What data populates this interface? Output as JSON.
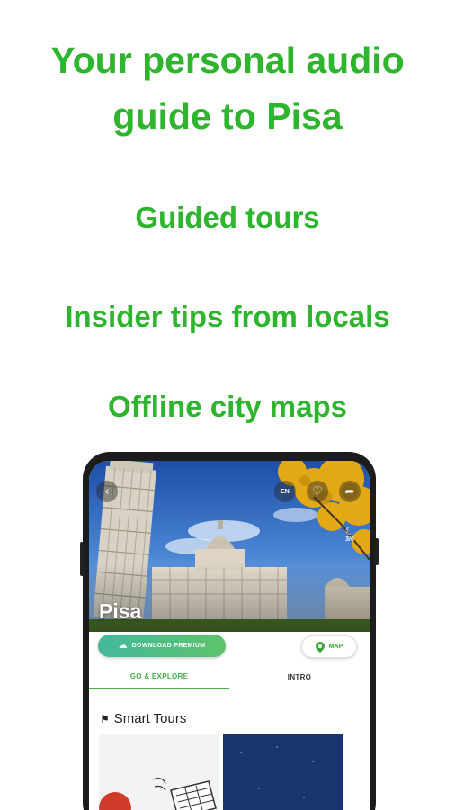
{
  "headline": "Your personal audio guide to Pisa",
  "headline_lines": [
    "Your personal audio",
    "guide to Pisa"
  ],
  "features": [
    "Guided tours",
    "Insider tips from locals",
    "Offline city maps"
  ],
  "colors": {
    "accent": "#2db52d",
    "tab_active": "#45b045",
    "download_gradient": [
      "#43b99d",
      "#5dc36b"
    ]
  },
  "phone": {
    "header_icons": {
      "back": "chevron-left-icon",
      "language": "EN",
      "favorite": "heart-icon",
      "share": "share-icon"
    },
    "night_mode": {
      "icon": "moon-icon",
      "value": "3/6"
    },
    "city_title": "Pisa",
    "download_button": {
      "icon": "cloud-download-icon",
      "label": "DOWNLOAD PREMIUM"
    },
    "map_button": {
      "icon": "map-pin-icon",
      "label": "MAP"
    },
    "tabs": [
      {
        "label": "GO & EXPLORE",
        "active": true
      },
      {
        "label": "INTRO",
        "active": false
      }
    ],
    "section": {
      "icon": "walking-tour-icon",
      "title": "Smart Tours"
    }
  }
}
